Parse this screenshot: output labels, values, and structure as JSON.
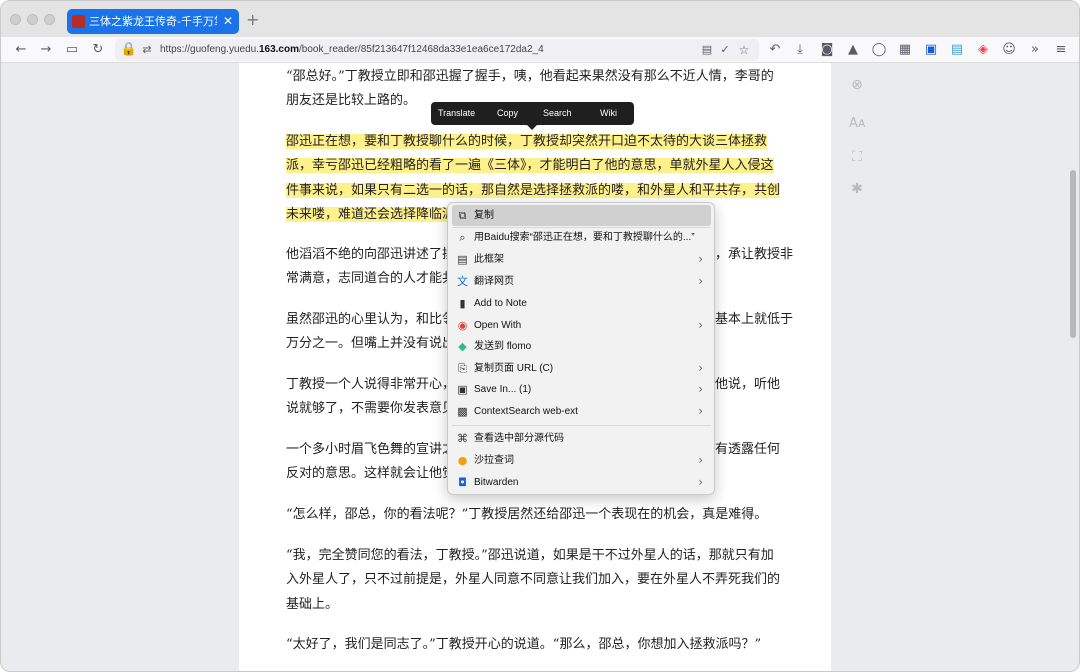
{
  "browser": {
    "tab_title": "三体之紫龙王传奇-千手万掌-免费",
    "tab_close": "✕",
    "new_tab": "+",
    "url_prefix": "https://guofeng.yuedu.",
    "url_domain": "163.com",
    "url_path": "/book_reader/85f213647f12468da33e1ea6ce172da2_4"
  },
  "selection_popover": [
    "Translate",
    "Copy",
    "Search",
    "Wiki"
  ],
  "paragraphs": [
    [
      "“邵总好。”丁教授立即和邵迅握了握手，咦，他看起来果然没有那么不近人情，李哥的",
      "朋友还是比较上路的。"
    ],
    [
      "邵迅正在想，要和丁教授聊什么的时候，丁教授却突然开口迫不太待的大谈三体拯救",
      "派，幸亏邵迅已经粗略的看了一遍《三体》，才能明白了他的意思，单就外星人入侵这",
      "件事来说，如果只有二选一的话，那自然是选择拯救派的喽，和外星人和平共存，共创",
      "未来喽，难道还会选择降临派吗？"
    ],
    [
      "他滔滔不绝的向邵迅讲述了拯救派的理念，邵迅耐心地听着，不时点头附和，承让教授非",
      "常满意，志同道合的人才能共事。"
    ],
    [
      "虽然邵迅的心里认为，和比邻星人和平相处的可能性微乎其微，成功的概率基本上就低于",
      "万分之一。但嘴上并没有说出来。"
    ],
    [
      "丁教授一个人说得非常开心，邵迅想要插几句话，丁教授却摆了摆手，示意他说，听他",
      "说就够了，不需要你发表意见。"
    ],
    [
      "一个多小时眉飞色舞的宣讲之后，丁教授终于停了下来，邵迅自始至终都没有透露任何",
      "反对的意思。这样就会让他觉得，邵迅是认同他的观点的。"
    ],
    [
      "“怎么样，邵总，你的看法呢？”丁教授居然还给邵迅一个表现在的机会，真是难得。"
    ],
    [
      "“我，完全赞同您的看法，丁教授。”邵迅说道，如果是干不过外星人的话，那就只有加",
      "入外星人了，只不过前提是，外星人同意不同意让我们加入，要在外星人不弄死我们的",
      "基础上。"
    ],
    [
      "“太好了，我们是同志了。”丁教授开心的说道。“那么，邵总，你想加入拯救派吗？”"
    ]
  ],
  "context_menu": {
    "items": [
      {
        "label": "复制",
        "icon": "copy-icon",
        "submenu": false,
        "active": true
      },
      {
        "label": "用Baidu搜索“邵迅正在想，要和丁教授聊什么的...”",
        "icon": "search-icon",
        "submenu": false
      },
      {
        "label": "此框架",
        "icon": "frame-icon",
        "submenu": true
      },
      {
        "label": "翻译网页",
        "icon": "translate-icon",
        "submenu": true
      },
      {
        "label": "Add to Note",
        "icon": "note-icon",
        "submenu": false
      },
      {
        "label": "Open With",
        "icon": "chrome-icon",
        "submenu": true
      },
      {
        "label": "发送到 flomo",
        "icon": "flomo-icon",
        "submenu": false
      },
      {
        "label": "复制页面 URL (C)",
        "icon": "clipboard-icon",
        "submenu": true
      },
      {
        "label": "Save In... (1)",
        "icon": "save-icon",
        "submenu": true
      },
      {
        "label": "ContextSearch web-ext",
        "icon": "contextsearch-icon",
        "submenu": true
      },
      {
        "label": "查看选中部分源代码",
        "icon": "source-icon",
        "submenu": false
      },
      {
        "label": "沙拉查词",
        "icon": "saladict-icon",
        "submenu": true
      },
      {
        "label": "Bitwarden",
        "icon": "bitwarden-icon",
        "submenu": true
      }
    ]
  },
  "reader_sidebar": [
    "close-icon",
    "font-size-icon",
    "fullscreen-icon",
    "bug-icon"
  ],
  "colors": {
    "highlight": "#fef08a",
    "tab_active": "#1a73e8",
    "page_bg": "#e9ecee"
  }
}
